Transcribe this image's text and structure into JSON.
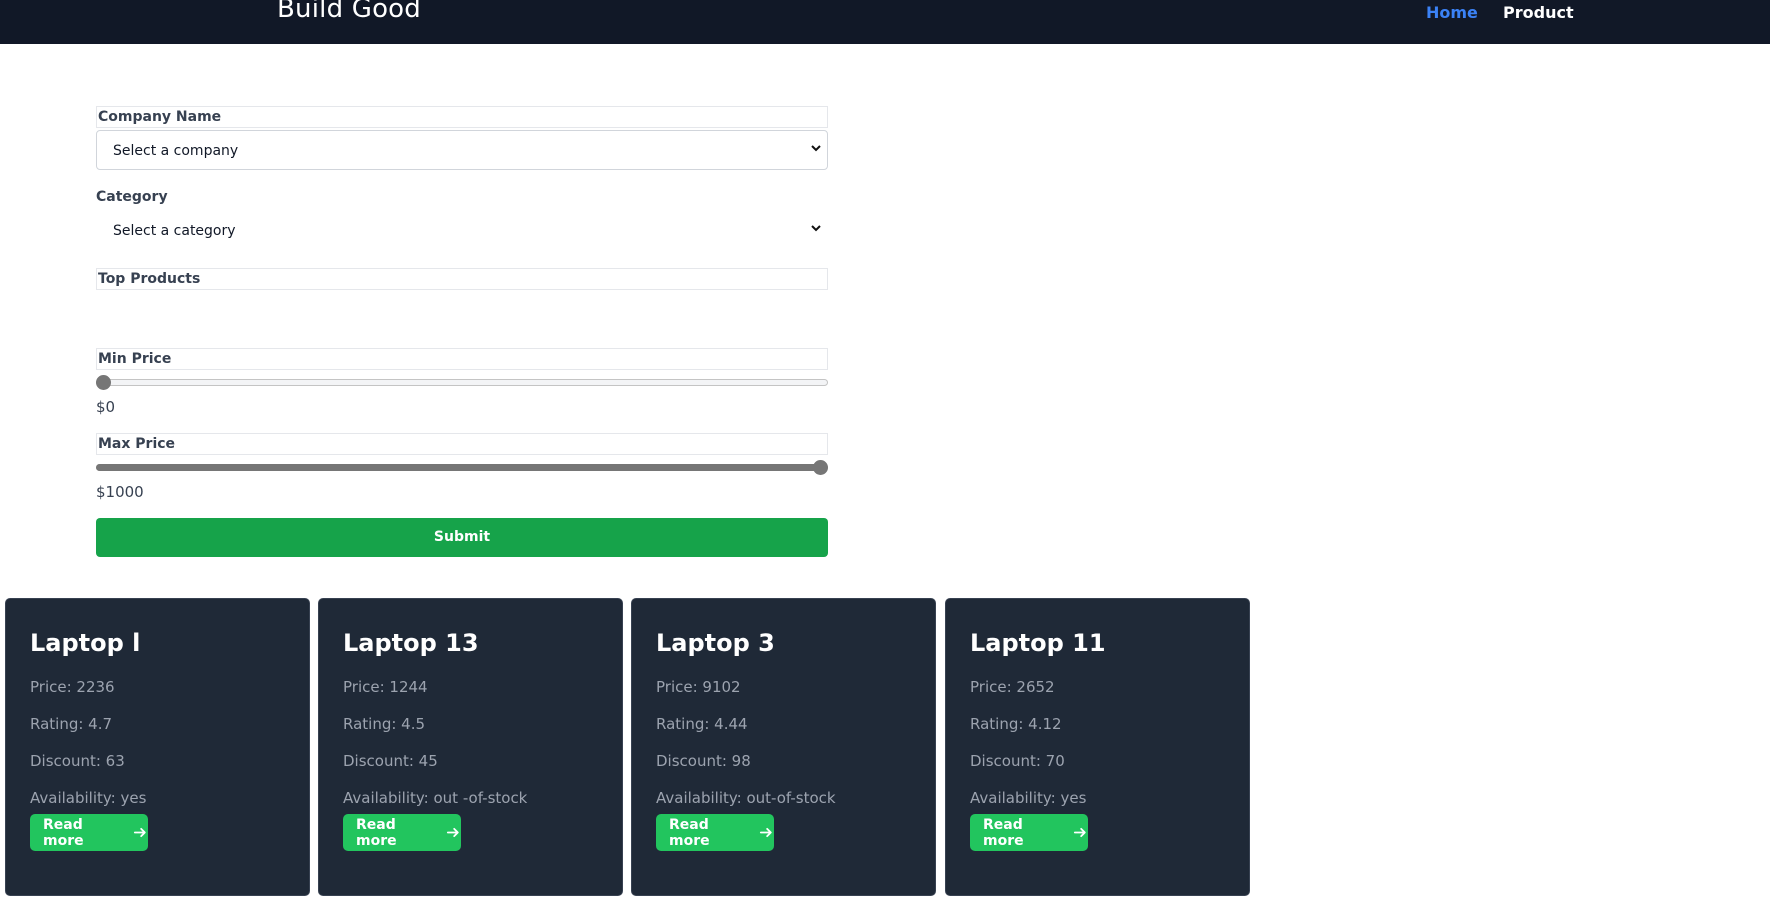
{
  "header": {
    "brand": "Build Good",
    "nav": [
      {
        "label": "Home",
        "active": true
      },
      {
        "label": "Product",
        "active": false
      }
    ]
  },
  "form": {
    "company": {
      "label": "Company Name",
      "selected": "Select a company"
    },
    "category": {
      "label": "Category",
      "selected": "Select a category"
    },
    "top_products": {
      "label": "Top Products"
    },
    "min_price": {
      "label": "Min Price",
      "value": 0,
      "display": "$0",
      "max": 1000
    },
    "max_price": {
      "label": "Max Price",
      "value": 1000,
      "display": "$1000",
      "max": 1000
    },
    "submit_label": "Submit"
  },
  "products": [
    {
      "name": "Laptop l",
      "price": "Price: 2236",
      "rating": "Rating: 4.7",
      "discount": "Discount: 63",
      "availability": "Availability: yes",
      "cta": "Read more"
    },
    {
      "name": "Laptop 13",
      "price": "Price: 1244",
      "rating": "Rating: 4.5",
      "discount": "Discount: 45",
      "availability": "Availability: out -of-stock",
      "cta": "Read more"
    },
    {
      "name": "Laptop 3",
      "price": "Price: 9102",
      "rating": "Rating: 4.44",
      "discount": "Discount: 98",
      "availability": "Availability: out-of-stock",
      "cta": "Read more"
    },
    {
      "name": "Laptop 11",
      "price": "Price: 2652",
      "rating": "Rating: 4.12",
      "discount": "Discount: 70",
      "availability": "Availability: yes",
      "cta": "Read more"
    }
  ],
  "colors": {
    "navbar": "#111827",
    "nav_active": "#3b82f6",
    "submit": "#16a34a",
    "card_bg": "#1f2937",
    "read_more": "#22c55e"
  },
  "icons": {
    "select_indicator": "chevron-down-icon",
    "read_more": "arrow-right-icon"
  }
}
